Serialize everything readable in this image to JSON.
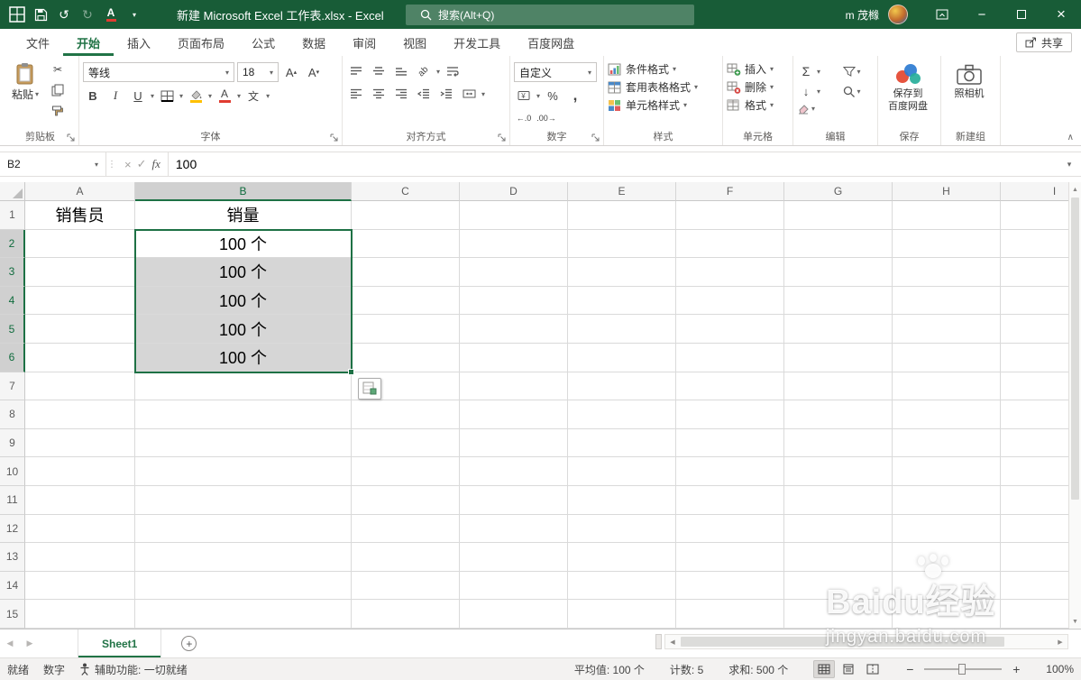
{
  "colors": {
    "titlebar_green": "#185C37",
    "accent_green": "#217346",
    "selection_border": "#1E7145",
    "selected_fill": "#D6D6D6",
    "selected_header": "#D0D0D0"
  },
  "titlebar": {
    "title": "新建 Microsoft Excel 工作表.xlsx - Excel",
    "search_placeholder": "搜索(Alt+Q)",
    "user": "m 茂橼"
  },
  "tabs": [
    {
      "label": "文件",
      "active": false
    },
    {
      "label": "开始",
      "active": true
    },
    {
      "label": "插入",
      "active": false
    },
    {
      "label": "页面布局",
      "active": false
    },
    {
      "label": "公式",
      "active": false
    },
    {
      "label": "数据",
      "active": false
    },
    {
      "label": "审阅",
      "active": false
    },
    {
      "label": "视图",
      "active": false
    },
    {
      "label": "开发工具",
      "active": false
    },
    {
      "label": "百度网盘",
      "active": false
    }
  ],
  "share_button": "共享",
  "ribbon": {
    "clipboard": {
      "label": "剪贴板",
      "paste": "粘贴"
    },
    "font": {
      "label": "字体",
      "name": "等线",
      "size": "18"
    },
    "alignment": {
      "label": "对齐方式"
    },
    "number": {
      "label": "数字",
      "format": "自定义"
    },
    "styles": {
      "label": "样式",
      "conditional": "条件格式",
      "table": "套用表格格式",
      "cell": "单元格样式"
    },
    "cells": {
      "label": "单元格",
      "insert": "插入",
      "delete": "删除",
      "format": "格式"
    },
    "editing": {
      "label": "编辑"
    },
    "save": {
      "label": "保存",
      "line1": "保存到",
      "line2": "百度网盘"
    },
    "newgroup": {
      "label": "新建组",
      "camera": "照相机"
    }
  },
  "formula_bar": {
    "name_box": "B2",
    "formula": "100"
  },
  "grid": {
    "columns": [
      "A",
      "B",
      "C",
      "D",
      "E",
      "F",
      "G",
      "H",
      "I"
    ],
    "row_count": 15,
    "cells": {
      "A1": "销售员",
      "B1": "销量",
      "B2": "100 个",
      "B3": "100 个",
      "B4": "100 个",
      "B5": "100 个",
      "B6": "100 个"
    },
    "selection": {
      "active": "B2",
      "col": "B",
      "row_start": 2,
      "row_end": 6
    }
  },
  "sheet_bar": {
    "active_sheet": "Sheet1"
  },
  "status_bar": {
    "ready": "就绪",
    "num_lock": "数字",
    "accessibility": "辅助功能: 一切就绪",
    "average": "平均值: 100 个",
    "count": "计数: 5",
    "sum": "求和: 500 个",
    "zoom": "100%"
  },
  "watermark": {
    "brand": "Baidu经验",
    "url": "jingyan.baidu.com"
  }
}
